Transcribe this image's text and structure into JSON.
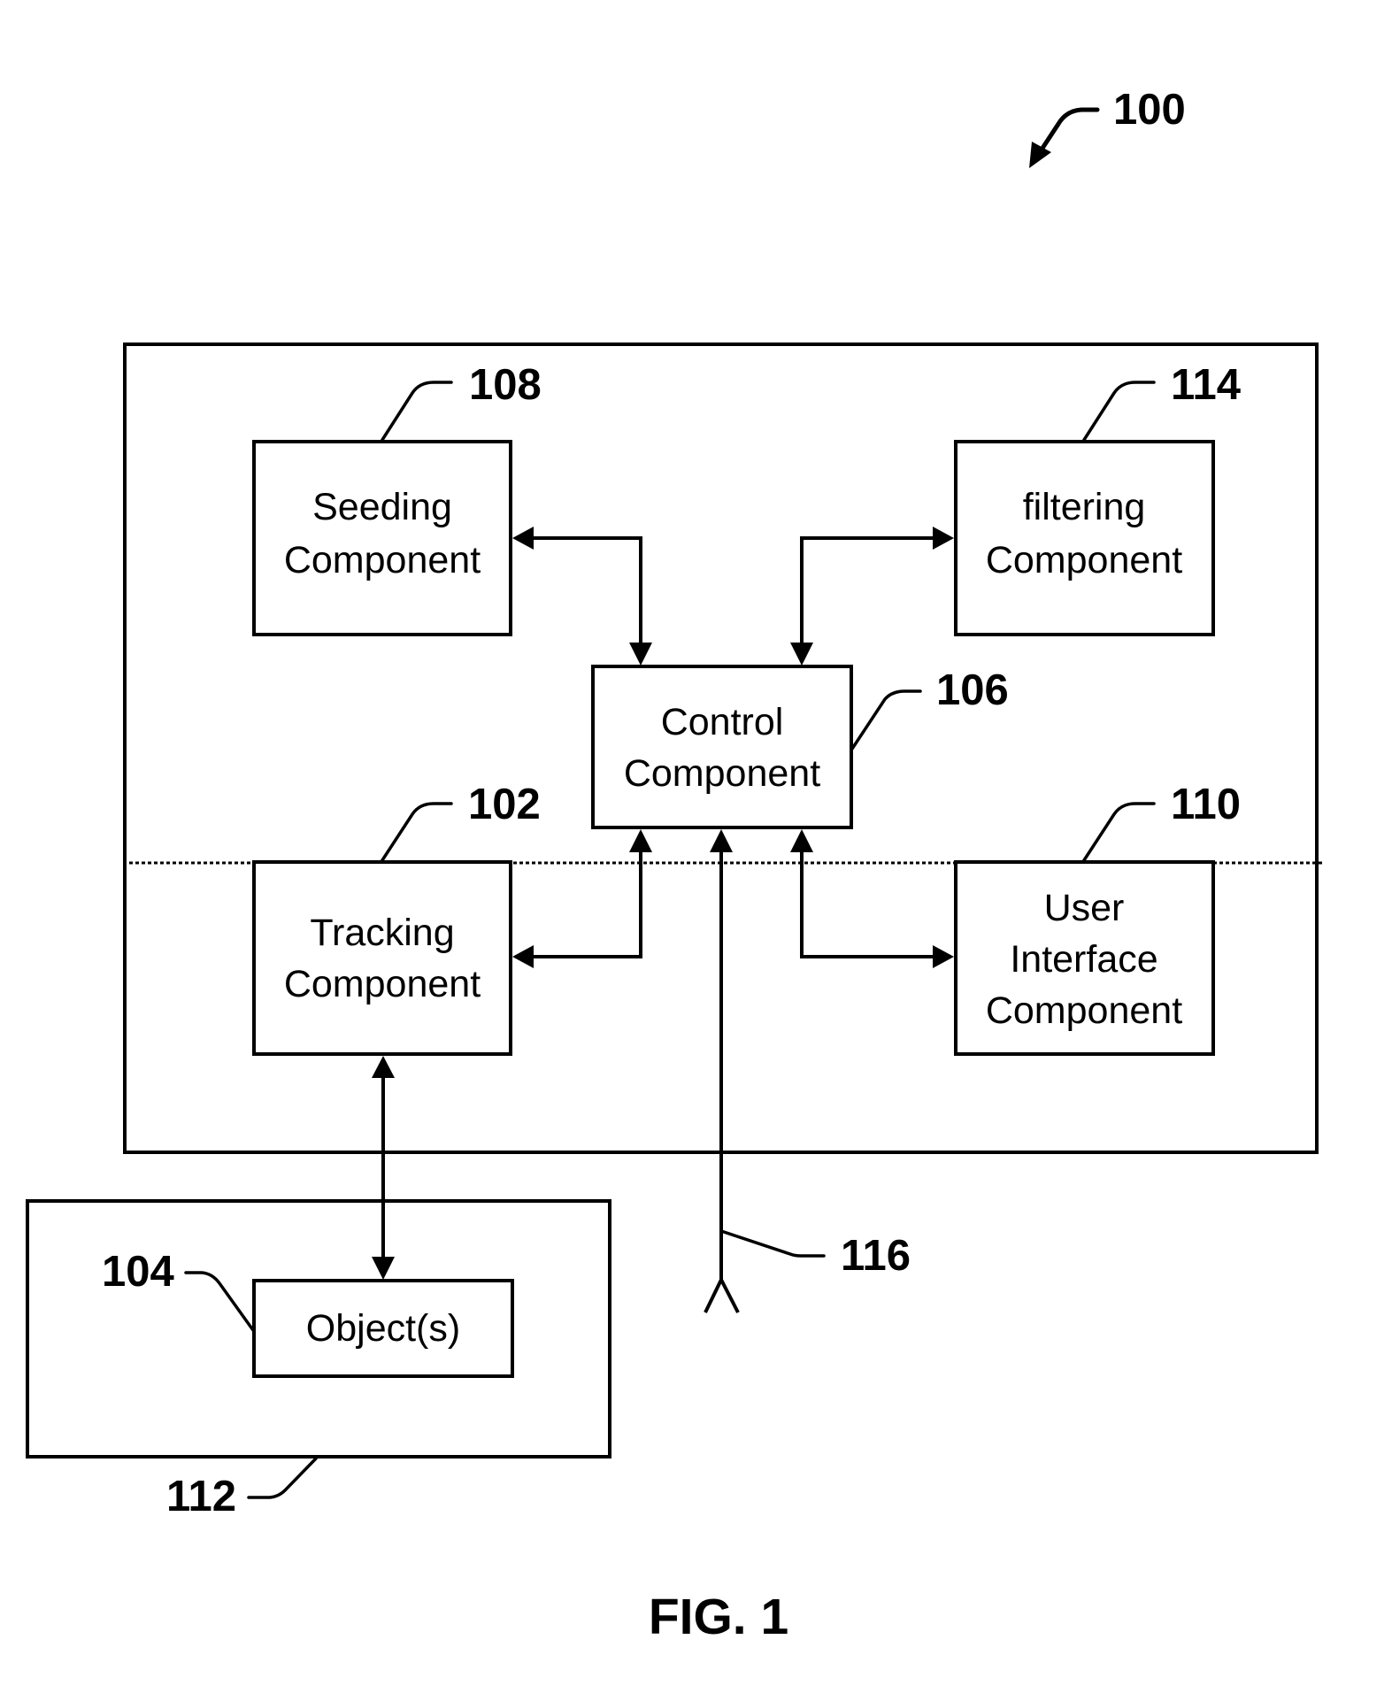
{
  "figure": {
    "title": "FIG. 1",
    "system_ref": "100"
  },
  "components": {
    "seeding": {
      "ref": "108",
      "lines": [
        "Seeding",
        "Component"
      ]
    },
    "filtering": {
      "ref": "114",
      "lines": [
        "filtering",
        "Component"
      ]
    },
    "control": {
      "ref": "106",
      "lines": [
        "Control",
        "Component"
      ]
    },
    "tracking": {
      "ref": "102",
      "lines": [
        "Tracking",
        "Component"
      ]
    },
    "user_interface": {
      "ref": "110",
      "lines": [
        "User",
        "Interface",
        "Component"
      ]
    },
    "objects": {
      "ref": "104",
      "lines": [
        "Object(s)"
      ]
    }
  },
  "environment": {
    "ref": "112"
  },
  "antenna": {
    "ref": "116"
  },
  "connections": [
    {
      "from": "control",
      "to": "seeding",
      "type": "bidirectional"
    },
    {
      "from": "control",
      "to": "filtering",
      "type": "bidirectional"
    },
    {
      "from": "control",
      "to": "tracking",
      "type": "bidirectional"
    },
    {
      "from": "control",
      "to": "user_interface",
      "type": "bidirectional"
    },
    {
      "from": "tracking",
      "to": "objects",
      "type": "bidirectional"
    },
    {
      "from": "antenna",
      "to": "control",
      "type": "input"
    }
  ]
}
